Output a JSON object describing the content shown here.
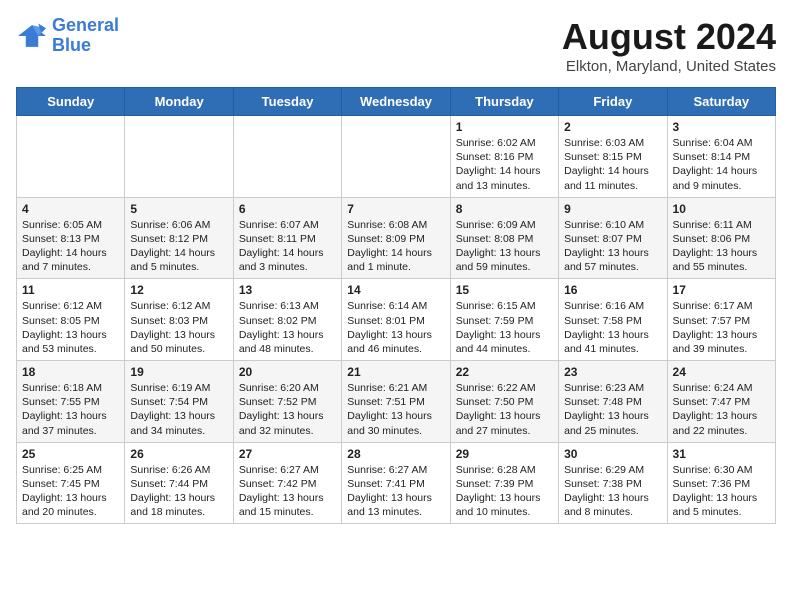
{
  "logo": {
    "text_general": "General",
    "text_blue": "Blue"
  },
  "title": "August 2024",
  "subtitle": "Elkton, Maryland, United States",
  "weekdays": [
    "Sunday",
    "Monday",
    "Tuesday",
    "Wednesday",
    "Thursday",
    "Friday",
    "Saturday"
  ],
  "weeks": [
    [
      {
        "day": "",
        "info": ""
      },
      {
        "day": "",
        "info": ""
      },
      {
        "day": "",
        "info": ""
      },
      {
        "day": "",
        "info": ""
      },
      {
        "day": "1",
        "info": "Sunrise: 6:02 AM\nSunset: 8:16 PM\nDaylight: 14 hours\nand 13 minutes."
      },
      {
        "day": "2",
        "info": "Sunrise: 6:03 AM\nSunset: 8:15 PM\nDaylight: 14 hours\nand 11 minutes."
      },
      {
        "day": "3",
        "info": "Sunrise: 6:04 AM\nSunset: 8:14 PM\nDaylight: 14 hours\nand 9 minutes."
      }
    ],
    [
      {
        "day": "4",
        "info": "Sunrise: 6:05 AM\nSunset: 8:13 PM\nDaylight: 14 hours\nand 7 minutes."
      },
      {
        "day": "5",
        "info": "Sunrise: 6:06 AM\nSunset: 8:12 PM\nDaylight: 14 hours\nand 5 minutes."
      },
      {
        "day": "6",
        "info": "Sunrise: 6:07 AM\nSunset: 8:11 PM\nDaylight: 14 hours\nand 3 minutes."
      },
      {
        "day": "7",
        "info": "Sunrise: 6:08 AM\nSunset: 8:09 PM\nDaylight: 14 hours\nand 1 minute."
      },
      {
        "day": "8",
        "info": "Sunrise: 6:09 AM\nSunset: 8:08 PM\nDaylight: 13 hours\nand 59 minutes."
      },
      {
        "day": "9",
        "info": "Sunrise: 6:10 AM\nSunset: 8:07 PM\nDaylight: 13 hours\nand 57 minutes."
      },
      {
        "day": "10",
        "info": "Sunrise: 6:11 AM\nSunset: 8:06 PM\nDaylight: 13 hours\nand 55 minutes."
      }
    ],
    [
      {
        "day": "11",
        "info": "Sunrise: 6:12 AM\nSunset: 8:05 PM\nDaylight: 13 hours\nand 53 minutes."
      },
      {
        "day": "12",
        "info": "Sunrise: 6:12 AM\nSunset: 8:03 PM\nDaylight: 13 hours\nand 50 minutes."
      },
      {
        "day": "13",
        "info": "Sunrise: 6:13 AM\nSunset: 8:02 PM\nDaylight: 13 hours\nand 48 minutes."
      },
      {
        "day": "14",
        "info": "Sunrise: 6:14 AM\nSunset: 8:01 PM\nDaylight: 13 hours\nand 46 minutes."
      },
      {
        "day": "15",
        "info": "Sunrise: 6:15 AM\nSunset: 7:59 PM\nDaylight: 13 hours\nand 44 minutes."
      },
      {
        "day": "16",
        "info": "Sunrise: 6:16 AM\nSunset: 7:58 PM\nDaylight: 13 hours\nand 41 minutes."
      },
      {
        "day": "17",
        "info": "Sunrise: 6:17 AM\nSunset: 7:57 PM\nDaylight: 13 hours\nand 39 minutes."
      }
    ],
    [
      {
        "day": "18",
        "info": "Sunrise: 6:18 AM\nSunset: 7:55 PM\nDaylight: 13 hours\nand 37 minutes."
      },
      {
        "day": "19",
        "info": "Sunrise: 6:19 AM\nSunset: 7:54 PM\nDaylight: 13 hours\nand 34 minutes."
      },
      {
        "day": "20",
        "info": "Sunrise: 6:20 AM\nSunset: 7:52 PM\nDaylight: 13 hours\nand 32 minutes."
      },
      {
        "day": "21",
        "info": "Sunrise: 6:21 AM\nSunset: 7:51 PM\nDaylight: 13 hours\nand 30 minutes."
      },
      {
        "day": "22",
        "info": "Sunrise: 6:22 AM\nSunset: 7:50 PM\nDaylight: 13 hours\nand 27 minutes."
      },
      {
        "day": "23",
        "info": "Sunrise: 6:23 AM\nSunset: 7:48 PM\nDaylight: 13 hours\nand 25 minutes."
      },
      {
        "day": "24",
        "info": "Sunrise: 6:24 AM\nSunset: 7:47 PM\nDaylight: 13 hours\nand 22 minutes."
      }
    ],
    [
      {
        "day": "25",
        "info": "Sunrise: 6:25 AM\nSunset: 7:45 PM\nDaylight: 13 hours\nand 20 minutes."
      },
      {
        "day": "26",
        "info": "Sunrise: 6:26 AM\nSunset: 7:44 PM\nDaylight: 13 hours\nand 18 minutes."
      },
      {
        "day": "27",
        "info": "Sunrise: 6:27 AM\nSunset: 7:42 PM\nDaylight: 13 hours\nand 15 minutes."
      },
      {
        "day": "28",
        "info": "Sunrise: 6:27 AM\nSunset: 7:41 PM\nDaylight: 13 hours\nand 13 minutes."
      },
      {
        "day": "29",
        "info": "Sunrise: 6:28 AM\nSunset: 7:39 PM\nDaylight: 13 hours\nand 10 minutes."
      },
      {
        "day": "30",
        "info": "Sunrise: 6:29 AM\nSunset: 7:38 PM\nDaylight: 13 hours\nand 8 minutes."
      },
      {
        "day": "31",
        "info": "Sunrise: 6:30 AM\nSunset: 7:36 PM\nDaylight: 13 hours\nand 5 minutes."
      }
    ]
  ]
}
